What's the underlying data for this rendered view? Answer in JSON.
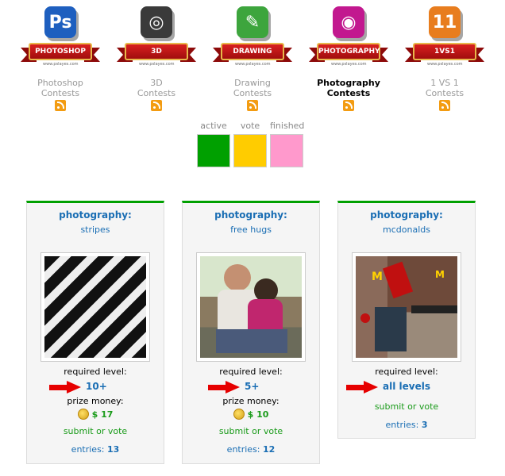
{
  "categories": [
    {
      "badge": "PHOTOSHOP",
      "site": "www.pslayes.com",
      "glyph": "Ps",
      "tile_color": "#1e5fbf",
      "label_line1": "Photoshop",
      "label_line2": "Contests",
      "active": false,
      "icon": "photoshop-icon"
    },
    {
      "badge": "3D",
      "site": "www.pslayes.com",
      "glyph": "◎",
      "tile_color": "#3a3a3a",
      "label_line1": "3D",
      "label_line2": "Contests",
      "active": false,
      "icon": "3d-icon"
    },
    {
      "badge": "DRAWING",
      "site": "www.pslayes.com",
      "glyph": "✎",
      "tile_color": "#3da53d",
      "label_line1": "Drawing",
      "label_line2": "Contests",
      "active": false,
      "icon": "drawing-pencil-icon"
    },
    {
      "badge": "PHOTOGRAPHY",
      "site": "www.pslayes.com",
      "glyph": "◉",
      "tile_color": "#c2188f",
      "label_line1": "Photography",
      "label_line2": "Contests",
      "active": true,
      "icon": "camera-icon"
    },
    {
      "badge": "1VS1",
      "site": "www.pslayes.com",
      "glyph": "11",
      "tile_color": "#e87d1e",
      "label_line1": "1 VS 1",
      "label_line2": "Contests",
      "active": false,
      "icon": "1vs1-icon"
    }
  ],
  "legend": [
    {
      "label": "active",
      "color": "#00a000"
    },
    {
      "label": "vote",
      "color": "#ffcc00"
    },
    {
      "label": "finished",
      "color": "#ff99cc"
    }
  ],
  "cards": [
    {
      "type": "photography:",
      "title": "stripes",
      "required_label": "required level:",
      "level": "10+",
      "prize_label": "prize money:",
      "prize": "$ 17",
      "submit": "submit or vote",
      "entries_label": "entries:",
      "entries": "13"
    },
    {
      "type": "photography:",
      "title": "free hugs",
      "required_label": "required level:",
      "level": "5+",
      "prize_label": "prize money:",
      "prize": "$ 10",
      "submit": "submit or vote",
      "entries_label": "entries:",
      "entries": "12"
    },
    {
      "type": "photography:",
      "title": "mcdonalds",
      "required_label": "required level:",
      "level": "all levels",
      "submit": "submit or vote",
      "entries_label": "entries:",
      "entries": "3"
    }
  ]
}
